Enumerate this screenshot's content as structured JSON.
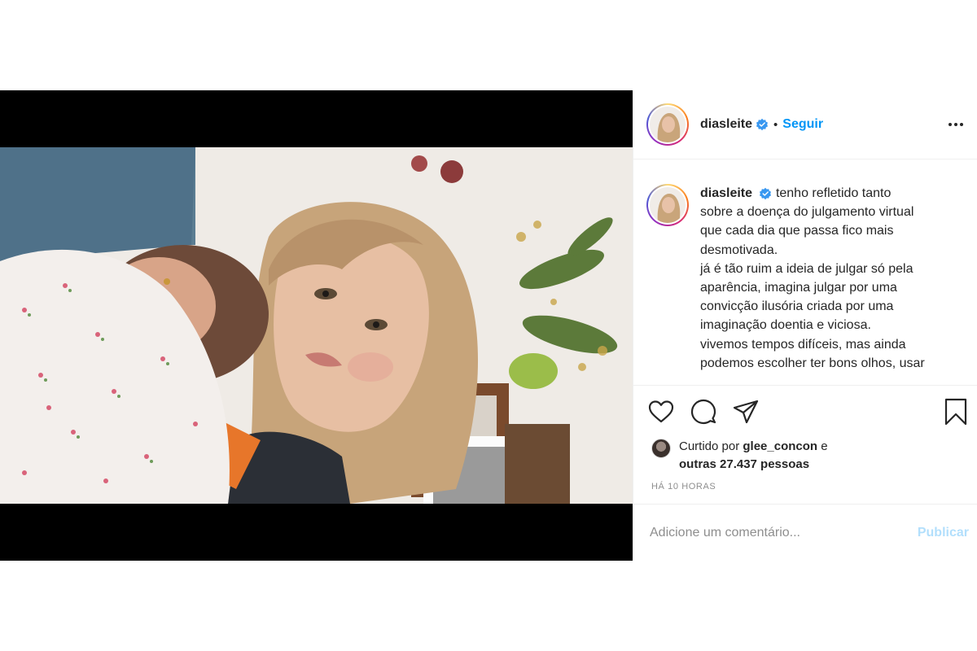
{
  "post": {
    "username": "diasleite",
    "follow_label": "Seguir",
    "separator": "•",
    "caption_lines": [
      "tenho refletido tanto",
      "sobre a doença do julgamento virtual",
      "que cada dia que passa fico mais",
      "desmotivada.",
      "já é tão ruim a ideia de julgar só pela",
      "aparência, imagina julgar por uma",
      "convicção ilusória criada por uma",
      "imaginação doentia e viciosa.",
      "vivemos tempos difíceis, mas ainda",
      "podemos escolher ter bons olhos, usar"
    ],
    "likes": {
      "prefix": "Curtido por",
      "user": "glee_concon",
      "conj": "e",
      "others": "outras 27.437 pessoas"
    },
    "timestamp": "HÁ 10 HORAS",
    "comment_placeholder": "Adicione um comentário...",
    "publish_label": "Publicar"
  },
  "icons": [
    "heart-icon",
    "comment-icon",
    "share-icon",
    "bookmark-icon",
    "more-options-icon",
    "verified-badge-icon"
  ],
  "colors": {
    "accent": "#0095f6",
    "publish_disabled": "#b2dffc",
    "muted": "#8e8e8e",
    "text": "#262626"
  }
}
